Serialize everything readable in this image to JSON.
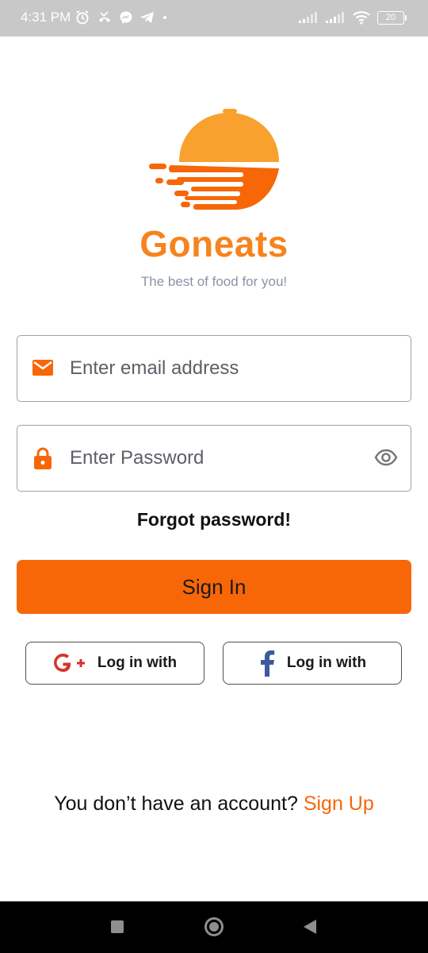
{
  "status_bar": {
    "time": "4:31 PM",
    "battery": "20",
    "left_icons": [
      "alarm-icon",
      "missed-call-icon",
      "messenger-icon",
      "telegram-icon",
      "dot-icon"
    ],
    "right_icons": [
      "signal-icon",
      "signal-icon",
      "wifi-icon",
      "battery-icon"
    ]
  },
  "brand": {
    "name": "Goneats",
    "tagline": "The best of food for you!",
    "colors": {
      "primary": "#f76707",
      "logo_light": "#f9a12e",
      "tagline": "#8a93a6"
    }
  },
  "form": {
    "email_placeholder": "Enter email address",
    "password_placeholder": "Enter Password",
    "forgot_label": "Forgot password!",
    "signin_label": "Sign In"
  },
  "social": {
    "google_label": "Log in with",
    "facebook_label": "Log in with"
  },
  "footer": {
    "prompt": "You don’t have an account?",
    "signup_label": "Sign Up"
  },
  "nav": [
    "recent-apps",
    "home",
    "back"
  ]
}
